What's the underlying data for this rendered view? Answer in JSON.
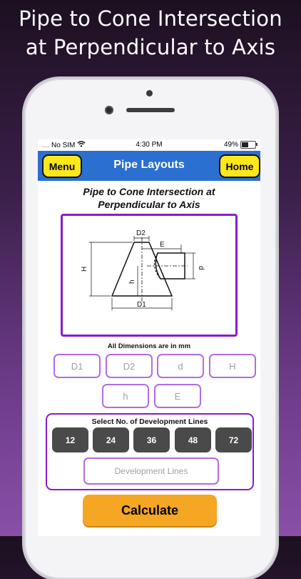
{
  "headline": {
    "line1": "Pipe to Cone Intersection",
    "line2": "at Perpendicular to Axis"
  },
  "status_bar": {
    "carrier": "No SIM",
    "signal_dots": "....",
    "time": "4:30 PM",
    "battery_percent": "49%",
    "battery_level": 0.49
  },
  "navbar": {
    "menu_label": "Menu",
    "title": "Pipe Layouts",
    "home_label": "Home",
    "color": "#2b6fd1",
    "button_color": "#ffe81a"
  },
  "calculator": {
    "title": "Pipe to Cone Intersection at Perpendicular to Axis",
    "diagram_labels": {
      "D2": "D2",
      "E": "E",
      "H": "H",
      "d": "d",
      "h": "h",
      "D1": "D1"
    },
    "units_note": "All Dimensions are in mm",
    "inputs": {
      "D1": {
        "placeholder": "D1",
        "value": ""
      },
      "D2": {
        "placeholder": "D2",
        "value": ""
      },
      "d": {
        "placeholder": "d",
        "value": ""
      },
      "H": {
        "placeholder": "H",
        "value": ""
      },
      "h": {
        "placeholder": "h",
        "value": ""
      },
      "E": {
        "placeholder": "E",
        "value": ""
      }
    },
    "development": {
      "label": "Select No. of Development Lines",
      "options": [
        "12",
        "24",
        "36",
        "48",
        "72"
      ],
      "input_placeholder": "Development Lines",
      "input_value": ""
    },
    "calculate_label": "Calculate",
    "accent_border": "#8a1bcf",
    "calculate_color": "#f5a623"
  }
}
